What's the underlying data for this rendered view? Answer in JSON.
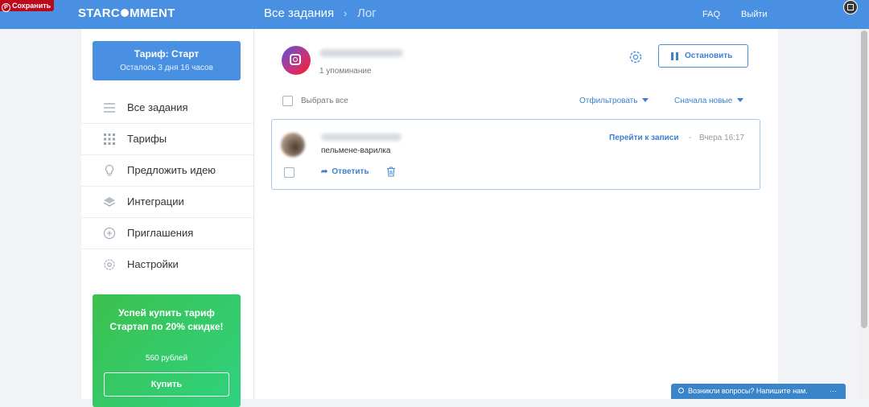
{
  "pin_button": {
    "label": "Сохранить"
  },
  "header": {
    "logo_left": "STARC",
    "logo_right": "MMENT",
    "breadcrumb_main": "Все задания",
    "breadcrumb_separator": "›",
    "breadcrumb_current": "Лог",
    "faq": "FAQ",
    "logout": "Выйти"
  },
  "sidebar": {
    "plan": {
      "title": "Тариф: Старт",
      "remaining": "Осталось 3 дня 16 часов"
    },
    "items": [
      {
        "label": "Все задания",
        "icon": "list-icon"
      },
      {
        "label": "Тарифы",
        "icon": "grid-icon"
      },
      {
        "label": "Предложить идею",
        "icon": "lightbulb-icon"
      },
      {
        "label": "Интеграции",
        "icon": "layers-icon"
      },
      {
        "label": "Приглашения",
        "icon": "plus-circle-icon"
      },
      {
        "label": "Настройки",
        "icon": "settings-icon"
      }
    ],
    "promo": {
      "title": "Успей купить тариф Стартап по 20% скидке!",
      "price": "560 рублей",
      "buy_label": "Купить"
    }
  },
  "task": {
    "account_name": "",
    "mentions": "1 упоминание",
    "stop_label": "Остановить"
  },
  "toolbar": {
    "select_all": "Выбрать все",
    "filter": "Отфильтровать",
    "sort": "Сначала новые"
  },
  "comments": [
    {
      "author": "",
      "text": "пельмене-варилка",
      "reply_label": "Ответить",
      "goto_label": "Перейти к записи",
      "separator": "-",
      "time": "Вчера 16:17"
    }
  ],
  "help_chat": {
    "label": "Возникли вопросы? Напишите нам.",
    "more": "···"
  },
  "colors": {
    "accent": "#4a90e2",
    "promo": "#3cc04e",
    "pinterest": "#bd081c"
  }
}
